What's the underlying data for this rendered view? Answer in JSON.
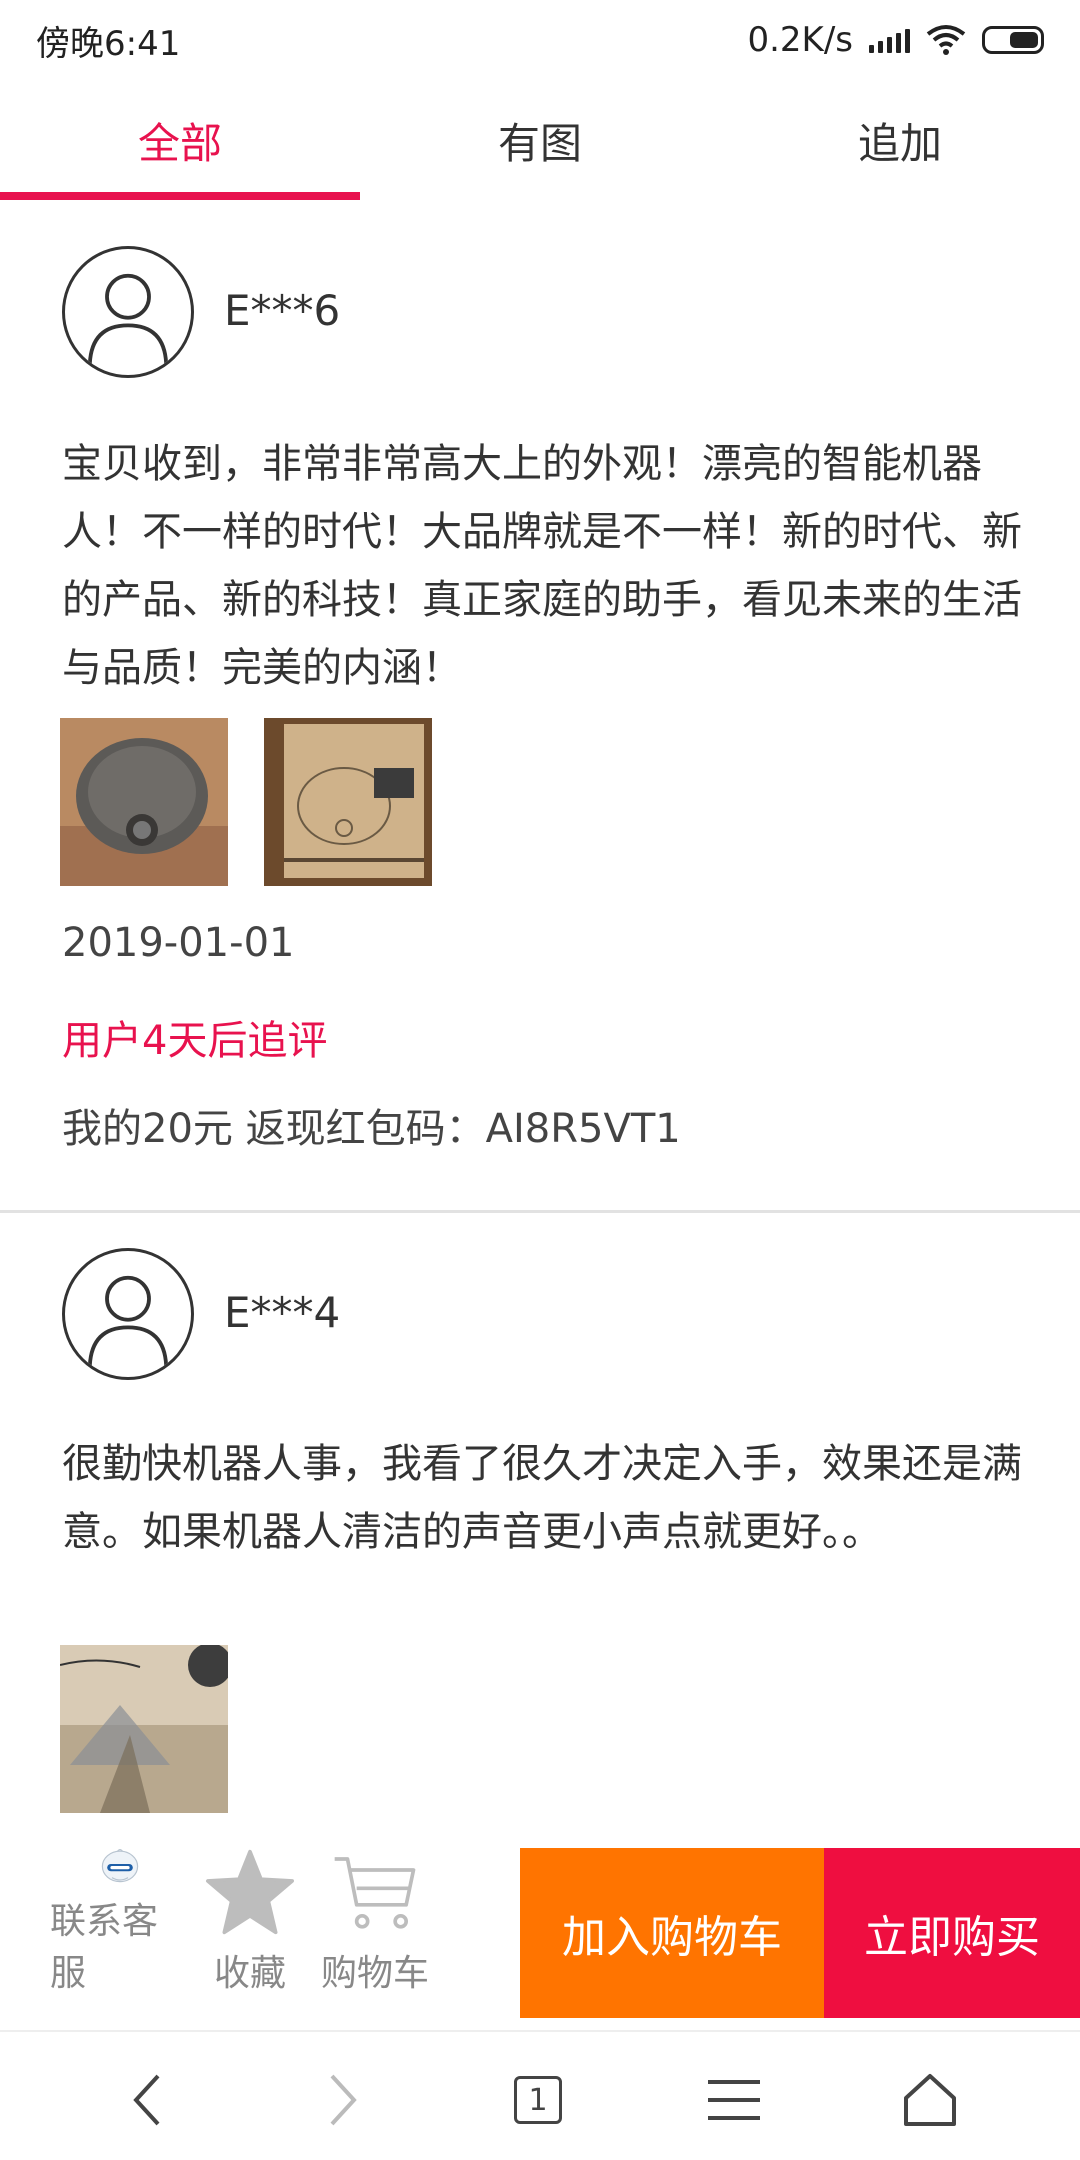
{
  "status_bar": {
    "time": "傍晚6:41",
    "net_speed": "0.2K/s",
    "icons": [
      "signal-icon",
      "wifi-icon",
      "battery-icon"
    ]
  },
  "tabs": [
    {
      "label": "全部",
      "active": true
    },
    {
      "label": "有图",
      "active": false
    },
    {
      "label": "追加",
      "active": false
    }
  ],
  "reviews": [
    {
      "user": "E***6",
      "text": "宝贝收到，非常非常高大上的外观！漂亮的智能机器人！不一样的时代！大品牌就是不一样！新的时代、新的产品、新的科技！真正家庭的助手，看见未来的生活与品质！完美的内涵！",
      "date": "2019-01-01",
      "followup_label": "用户4天后追评",
      "followup_text": "我的20元 返现红包码：AI8R5VT1"
    },
    {
      "user": "E***4",
      "text": "很勤快机器人事，我看了很久才决定入手，效果还是满意。如果机器人清洁的声音更小声点就更好。。"
    }
  ],
  "action_bar": {
    "service_label": "联系客服",
    "favorite_label": "收藏",
    "cart_label": "购物车",
    "add_to_cart": "加入购物车",
    "buy_now": "立即购买"
  },
  "nav_bar": {
    "tab_count": "1"
  },
  "colors": {
    "accent": "#e8124e",
    "add_to_cart_bg": "#ff7400",
    "buy_now_bg": "#ef0e40"
  }
}
